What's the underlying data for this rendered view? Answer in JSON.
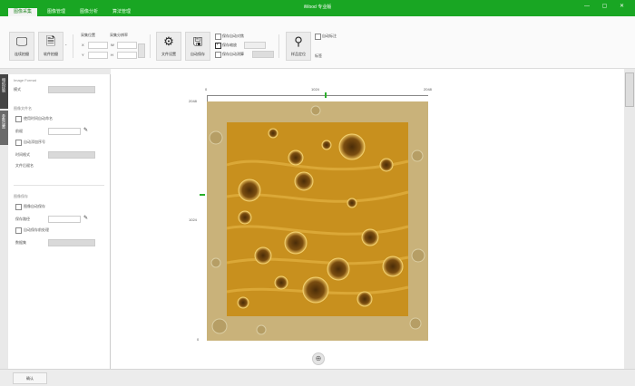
{
  "window": {
    "title": "iWood 专业版",
    "controls": "— ▢ ✕"
  },
  "tabs": [
    {
      "label": "图像采集",
      "active": true
    },
    {
      "label": "图像管理",
      "active": false
    },
    {
      "label": "图像分析",
      "active": false
    },
    {
      "label": "算法管理",
      "active": false
    }
  ],
  "toolbar": {
    "live_label": "连续拍摄",
    "file_label": "软件拍摄",
    "group_position": "采集位置",
    "group_size": "采集分辨率",
    "pos_x_label": "X",
    "pos_y_label": "Y",
    "size_w_label": "W",
    "size_h_label": "H",
    "settings_label": "文件设置",
    "save_label": "自动保存",
    "check_1": "保存自动对焦",
    "check_2": "保存缩放",
    "check_3": "保存自动测算",
    "locate_label": "样品定位",
    "check_4": "自动标注",
    "option_label": "标签"
  },
  "left_tabs": [
    "相机控制",
    "参数设置"
  ],
  "panel": {
    "image_format_label": "Image Format",
    "mode_label": "模式",
    "section_file": "图像文件名",
    "checkbox_auto_name": "使用时间自动命名",
    "prefix_label": "前缀",
    "checkbox_serial": "自动添加序号",
    "time_format_label": "时间格式",
    "file_suffix_label": "文件后缀名",
    "section_save": "图像保存",
    "checkbox_autosave": "图像自动保存",
    "save_path_label": "保存路径",
    "checkbox_compress": "自动保存前处理",
    "dataset_label": "数据集"
  },
  "canvas": {
    "x_ticks": [
      "0",
      "1024",
      "2048"
    ],
    "y_ticks": [
      "2048",
      "1024",
      "0"
    ],
    "zoom_icon_glyph": "⊕"
  },
  "status": {
    "left_button": "确认"
  },
  "colors": {
    "title_green": "#19a623",
    "micrograph_amber": "#c8901e"
  }
}
